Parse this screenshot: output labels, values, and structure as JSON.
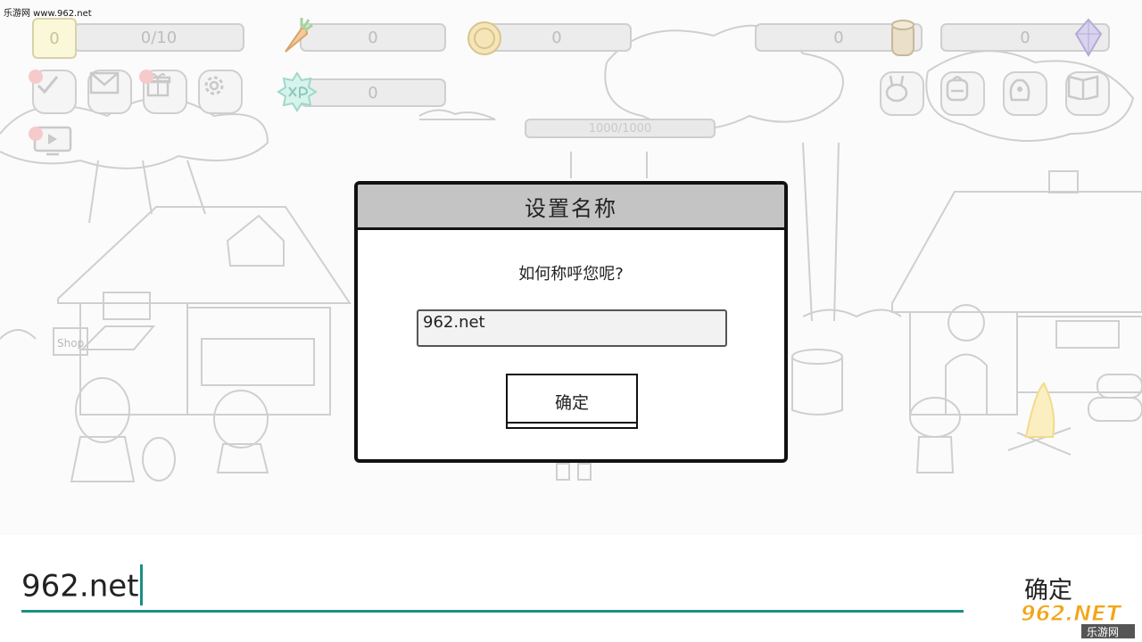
{
  "watermark_top": "乐游网 www.962.net",
  "hud": {
    "level": "0",
    "exp": "0/10",
    "carrot": "0",
    "coin": "0",
    "xp_points": "0",
    "wood": "0",
    "gem": "0",
    "hp": "1000/1000"
  },
  "scene": {
    "shop_sign": "Shop"
  },
  "dialog": {
    "title": "设置名称",
    "question": "如何称呼您呢?",
    "input_value": "962.net",
    "confirm_label": "确定"
  },
  "ime": {
    "text": "962.net",
    "confirm_label": "确定"
  },
  "logo": {
    "main": "962.NET",
    "sub": "乐游网"
  },
  "colors": {
    "accent": "#1a8f86",
    "dialog_title_bg": "#c4c4c4",
    "notification_dot": "#f6c9cb"
  }
}
